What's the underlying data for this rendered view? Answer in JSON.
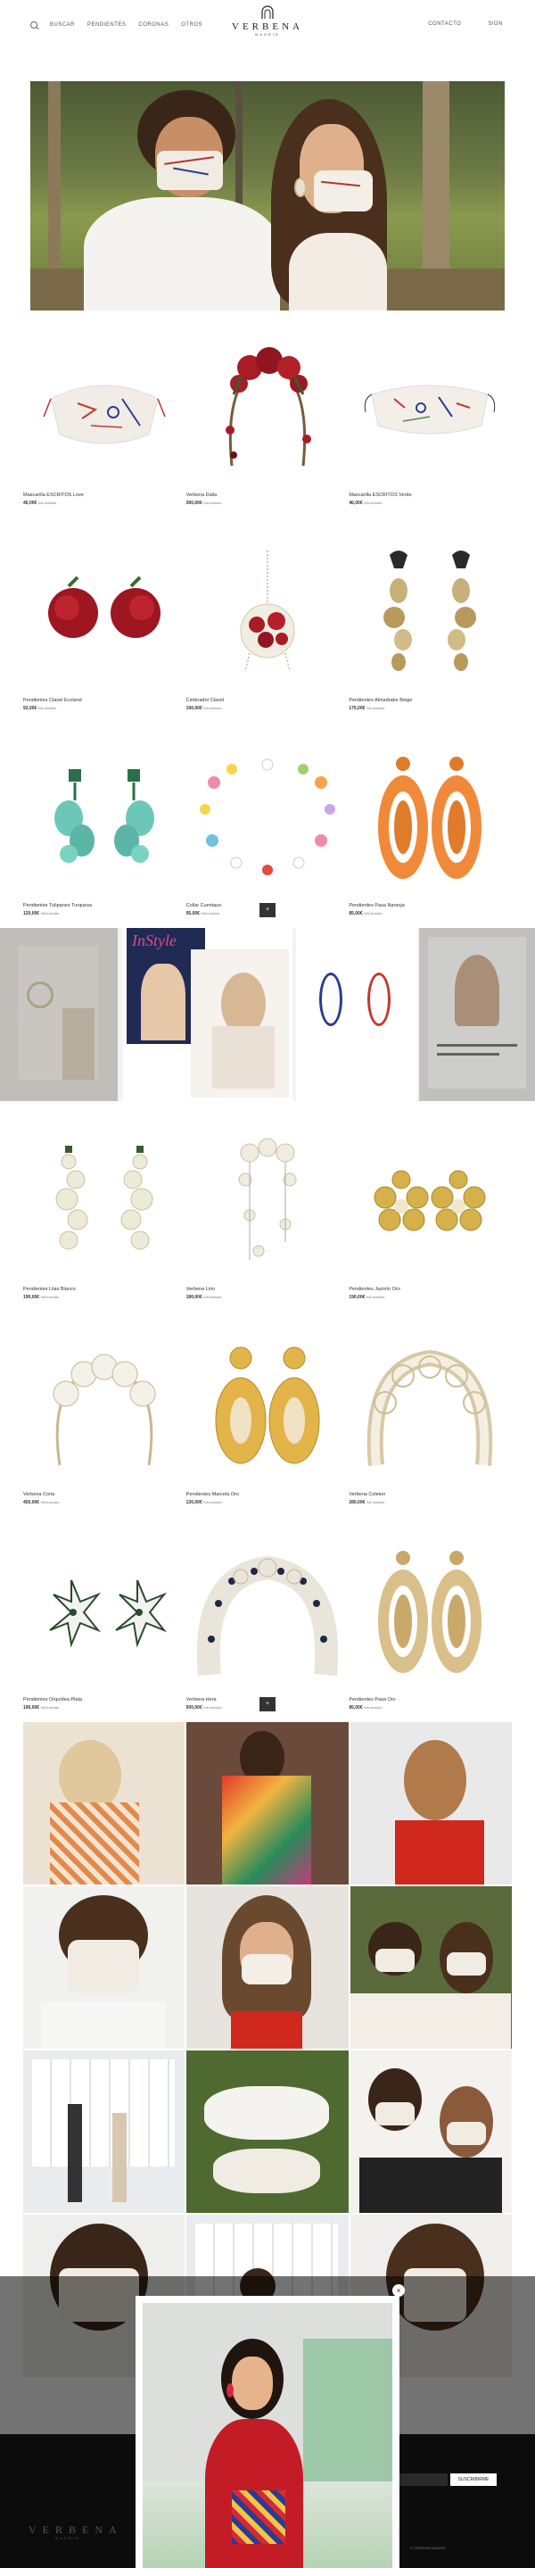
{
  "header": {
    "nav_left": [
      "BUSCAR",
      "PENDIENTES",
      "CORONAS",
      "OTROS"
    ],
    "logo_text": "VERBENA",
    "logo_sub": "MADRID",
    "nav_right": [
      "CONTACTO",
      "SIGN"
    ]
  },
  "products_section_1": [
    {
      "name": "Mascarilla ESCRITOS Love",
      "price": "46,00€",
      "tax": "IVA incluido"
    },
    {
      "name": "Verbena Dalia",
      "price": "390,00€",
      "tax": "IVA incluido"
    },
    {
      "name": "Mascarilla ESCRITOS Verde",
      "price": "46,00€",
      "tax": "IVA incluido"
    },
    {
      "name": "Pendientes Clavel Ecoland",
      "price": "92,00€",
      "tax": "IVA incluido"
    },
    {
      "name": "Cimbrador Clavel",
      "price": "190,00€",
      "tax": "IVA incluido"
    },
    {
      "name": "Pendientes Almadrabe Beige",
      "price": "175,00€",
      "tax": "IVA incluido"
    },
    {
      "name": "Pendientes Tulipanes Turquesa",
      "price": "120,00€",
      "tax": "IVA incluido"
    },
    {
      "name": "Collar Cuentaun",
      "price": "95,00€",
      "tax": "IVA incluido"
    },
    {
      "name": "Pendientes Pasa Naranja",
      "price": "85,00€",
      "tax": "IVA incluido"
    }
  ],
  "more_label_1": "+",
  "more_label_2": "+",
  "products_section_2": [
    {
      "name": "Pendientes Lilas Blanco",
      "price": "190,00€",
      "tax": "IVA incluido"
    },
    {
      "name": "Verbena Lirio",
      "price": "180,00€",
      "tax": "IVA incluido"
    },
    {
      "name": "Pendientes Jazmín Oro",
      "price": "190,00€",
      "tax": "IVA incluido"
    },
    {
      "name": "Verbena Coria",
      "price": "450,00€",
      "tax": "IVA incluido"
    },
    {
      "name": "Pendientes Marcela Oro",
      "price": "130,00€",
      "tax": "IVA incluido"
    },
    {
      "name": "Verbena Coleton",
      "price": "280,00€",
      "tax": "IVA incluido"
    },
    {
      "name": "Pendientes Orquídea Plata",
      "price": "190,00€",
      "tax": "IVA incluido"
    },
    {
      "name": "Verbena Hera",
      "price": "500,00€",
      "tax": "IVA incluido"
    },
    {
      "name": "Pendientes Pasa Oro",
      "price": "85,00€",
      "tax": "IVA incluido"
    }
  ],
  "press": {
    "magazine_title": "InStyle",
    "arrow_left": "‹",
    "arrow_right": "›"
  },
  "modal": {
    "close_label": "×"
  },
  "footer": {
    "logo_text": "VERBENA",
    "logo_sub": "MADRID",
    "newsletter_button": "SUSCRIBIRME",
    "copyright": "© VERBENA MADRID"
  },
  "colors": {
    "accent_dark": "#333333",
    "footer_bg": "#0c0c0c",
    "overlay": "rgba(0,0,0,0.55)"
  }
}
